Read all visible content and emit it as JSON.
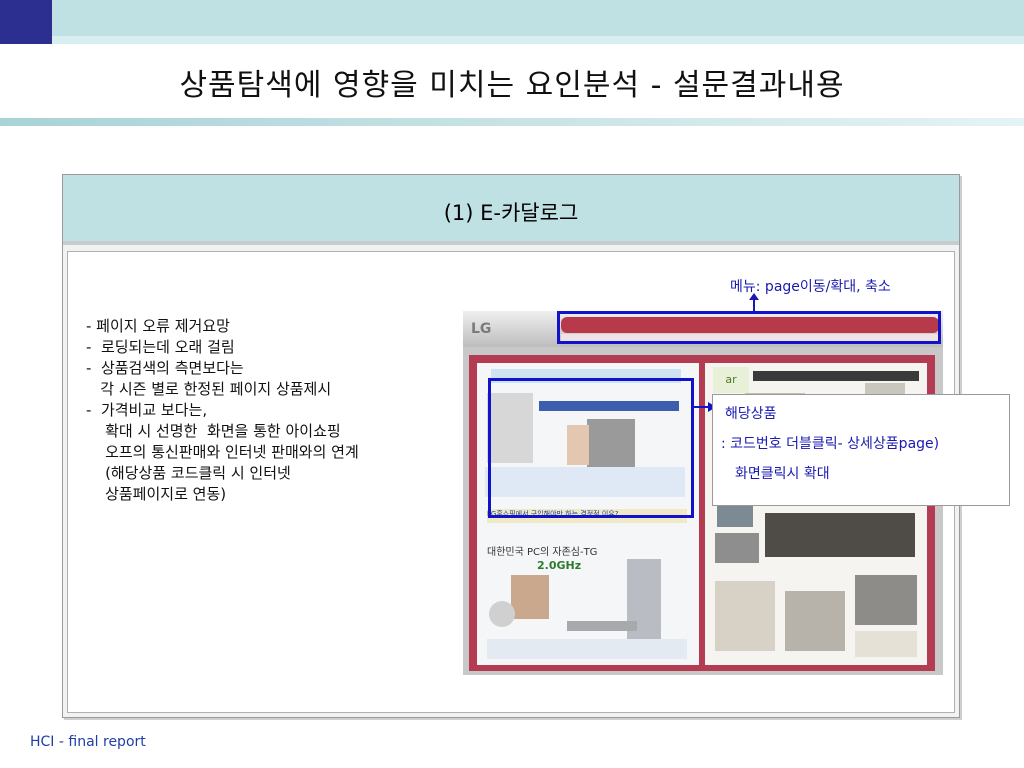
{
  "slide": {
    "title": "상품탐색에 영향을 미치는 요인분석 - 설문결과내용",
    "footer": "HCI - final report"
  },
  "card": {
    "title": "(1) E-카달로그"
  },
  "bullets": [
    "- 페이지 오류 제거요망",
    "-  로딩되는데 오래 걸림",
    "-  상품검색의 측면보다는",
    "   각 시즌 별로 한정된 페이지 상품제시",
    "-  가격비교 보다는,",
    "    확대 시 선명한  화면을 통한 아이쇼핑",
    "    오프의 통신판매와 인터넷 판매와의 연계",
    "    (해당상품 코드클릭 시 인터넷",
    "    상품페이지로 연동)"
  ],
  "annotations": {
    "menu_note": "메뉴: page이동/확대, 축소",
    "callout": [
      "해당상품",
      ": 코드번호 더블클릭- 상세상품page)",
      "화면클릭시 확대"
    ]
  },
  "screenshot": {
    "logo": "LG",
    "left_headline": "LG홈쇼핑에서 구입해야만 하는 결정적 이유?",
    "left_product": "대한민국 PC의 자존심-TG",
    "left_speed": "2.0GHz",
    "right_badge": "ar"
  },
  "colors": {
    "accent_blue": "#1212c8",
    "header_teal": "#bfe1e3",
    "brand_navy": "#2c2f8f",
    "catalog_red": "#b33c52"
  }
}
